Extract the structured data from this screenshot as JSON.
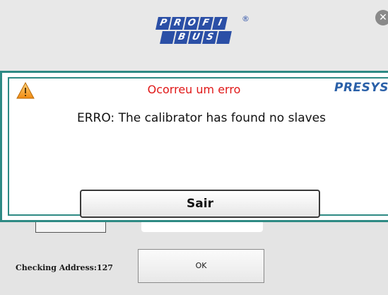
{
  "header": {
    "logo_top": [
      "P",
      "R",
      "O",
      "F",
      "I"
    ],
    "logo_bottom": [
      "B",
      "U",
      "S"
    ],
    "logo_reg": "®",
    "close_glyph": "✕"
  },
  "dialog": {
    "title": "Ocorreu um erro",
    "brand": "PRESYS",
    "message": "ERRO: The calibrator has found no slaves",
    "exit_label": "Sair"
  },
  "background_screen": {
    "checking_label": "Checking Address:127",
    "ok_label": "OK"
  },
  "colors": {
    "title_red": "#e01818",
    "frame_teal": "#2e8a84",
    "brand_blue": "#2a60a8",
    "warning_orange": "#f0a020"
  },
  "icons": {
    "warning": "warning-icon",
    "close": "close-icon"
  }
}
